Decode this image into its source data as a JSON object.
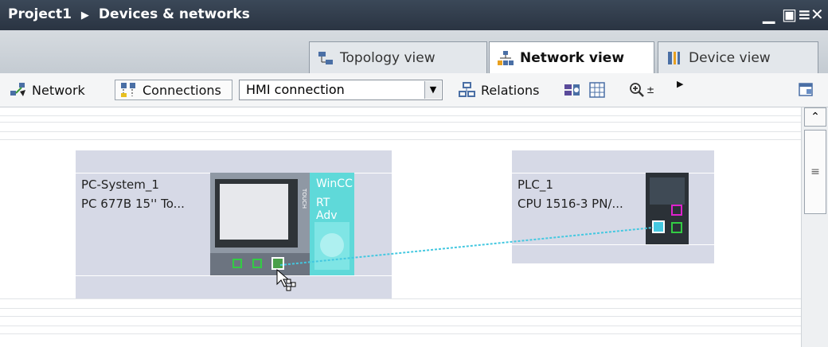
{
  "titlebar": {
    "project": "Project1",
    "separator": "▶",
    "section": "Devices & networks",
    "minimize": "▁",
    "restore": "▣",
    "menu": "≡",
    "close": "✕"
  },
  "tabs": {
    "topology": "Topology view",
    "network": "Network view",
    "device": "Device view",
    "active": "Network view"
  },
  "toolbar": {
    "network_label": "Network",
    "connections_label": "Connections",
    "connection_type": "HMI connection",
    "relations_label": "Relations"
  },
  "devices": {
    "pc": {
      "name": "PC-System_1",
      "model": "PC 677B 15'' To...",
      "hmi_line1": "WinCC",
      "hmi_line2": "RT Adv",
      "touch_text": "TOUCH"
    },
    "plc": {
      "name": "PLC_1",
      "model": "CPU 1516-3 PN/..."
    }
  },
  "colors": {
    "titlebar": "#2f3a48",
    "device_bg": "#d6d9e6",
    "wincc": "#55d8d8",
    "connection": "#44c8e0",
    "port_green": "#33cc44",
    "port_magenta": "#dd22cc"
  }
}
